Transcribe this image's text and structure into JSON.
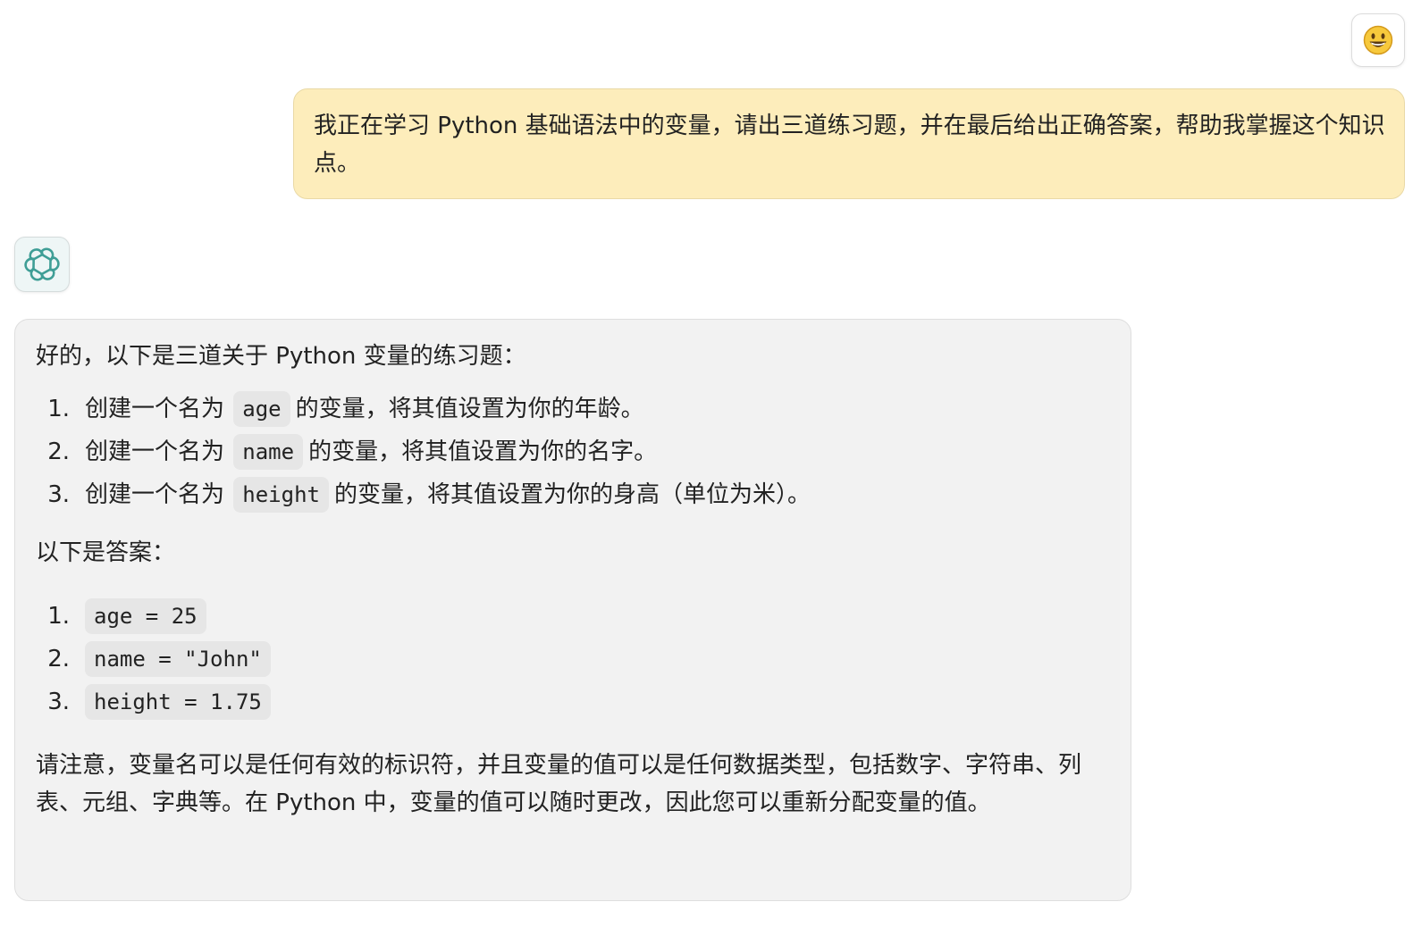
{
  "user": {
    "avatar_icon": "smiley-face-icon",
    "message": "我正在学习 Python 基础语法中的变量，请出三道练习题，并在最后给出正确答案，帮助我掌握这个知识点。"
  },
  "assistant": {
    "avatar_icon": "openai-logo-icon",
    "intro": "好的，以下是三道关于 Python 变量的练习题：",
    "questions": [
      {
        "num": "1.",
        "prefix": "创建一个名为",
        "code": "age",
        "suffix": "的变量，将其值设置为你的年龄。"
      },
      {
        "num": "2.",
        "prefix": "创建一个名为",
        "code": "name",
        "suffix": "的变量，将其值设置为你的名字。"
      },
      {
        "num": "3.",
        "prefix": "创建一个名为",
        "code": "height",
        "suffix": "的变量，将其值设置为你的身高（单位为米）。"
      }
    ],
    "answers_label": "以下是答案：",
    "answers": [
      {
        "num": "1.",
        "code": "age = 25"
      },
      {
        "num": "2.",
        "code": "name = \"John\""
      },
      {
        "num": "3.",
        "code": "height = 1.75"
      }
    ],
    "note": "请注意，变量名可以是任何有效的标识符，并且变量的值可以是任何数据类型，包括数字、字符串、列表、元组、字典等。在 Python 中，变量的值可以随时更改，因此您可以重新分配变量的值。"
  },
  "colors": {
    "user_bubble": "#fdedbb",
    "assistant_bubble": "#f2f2f2",
    "code_background": "#e6e6e6",
    "openai_logo": "#3f9e96"
  }
}
